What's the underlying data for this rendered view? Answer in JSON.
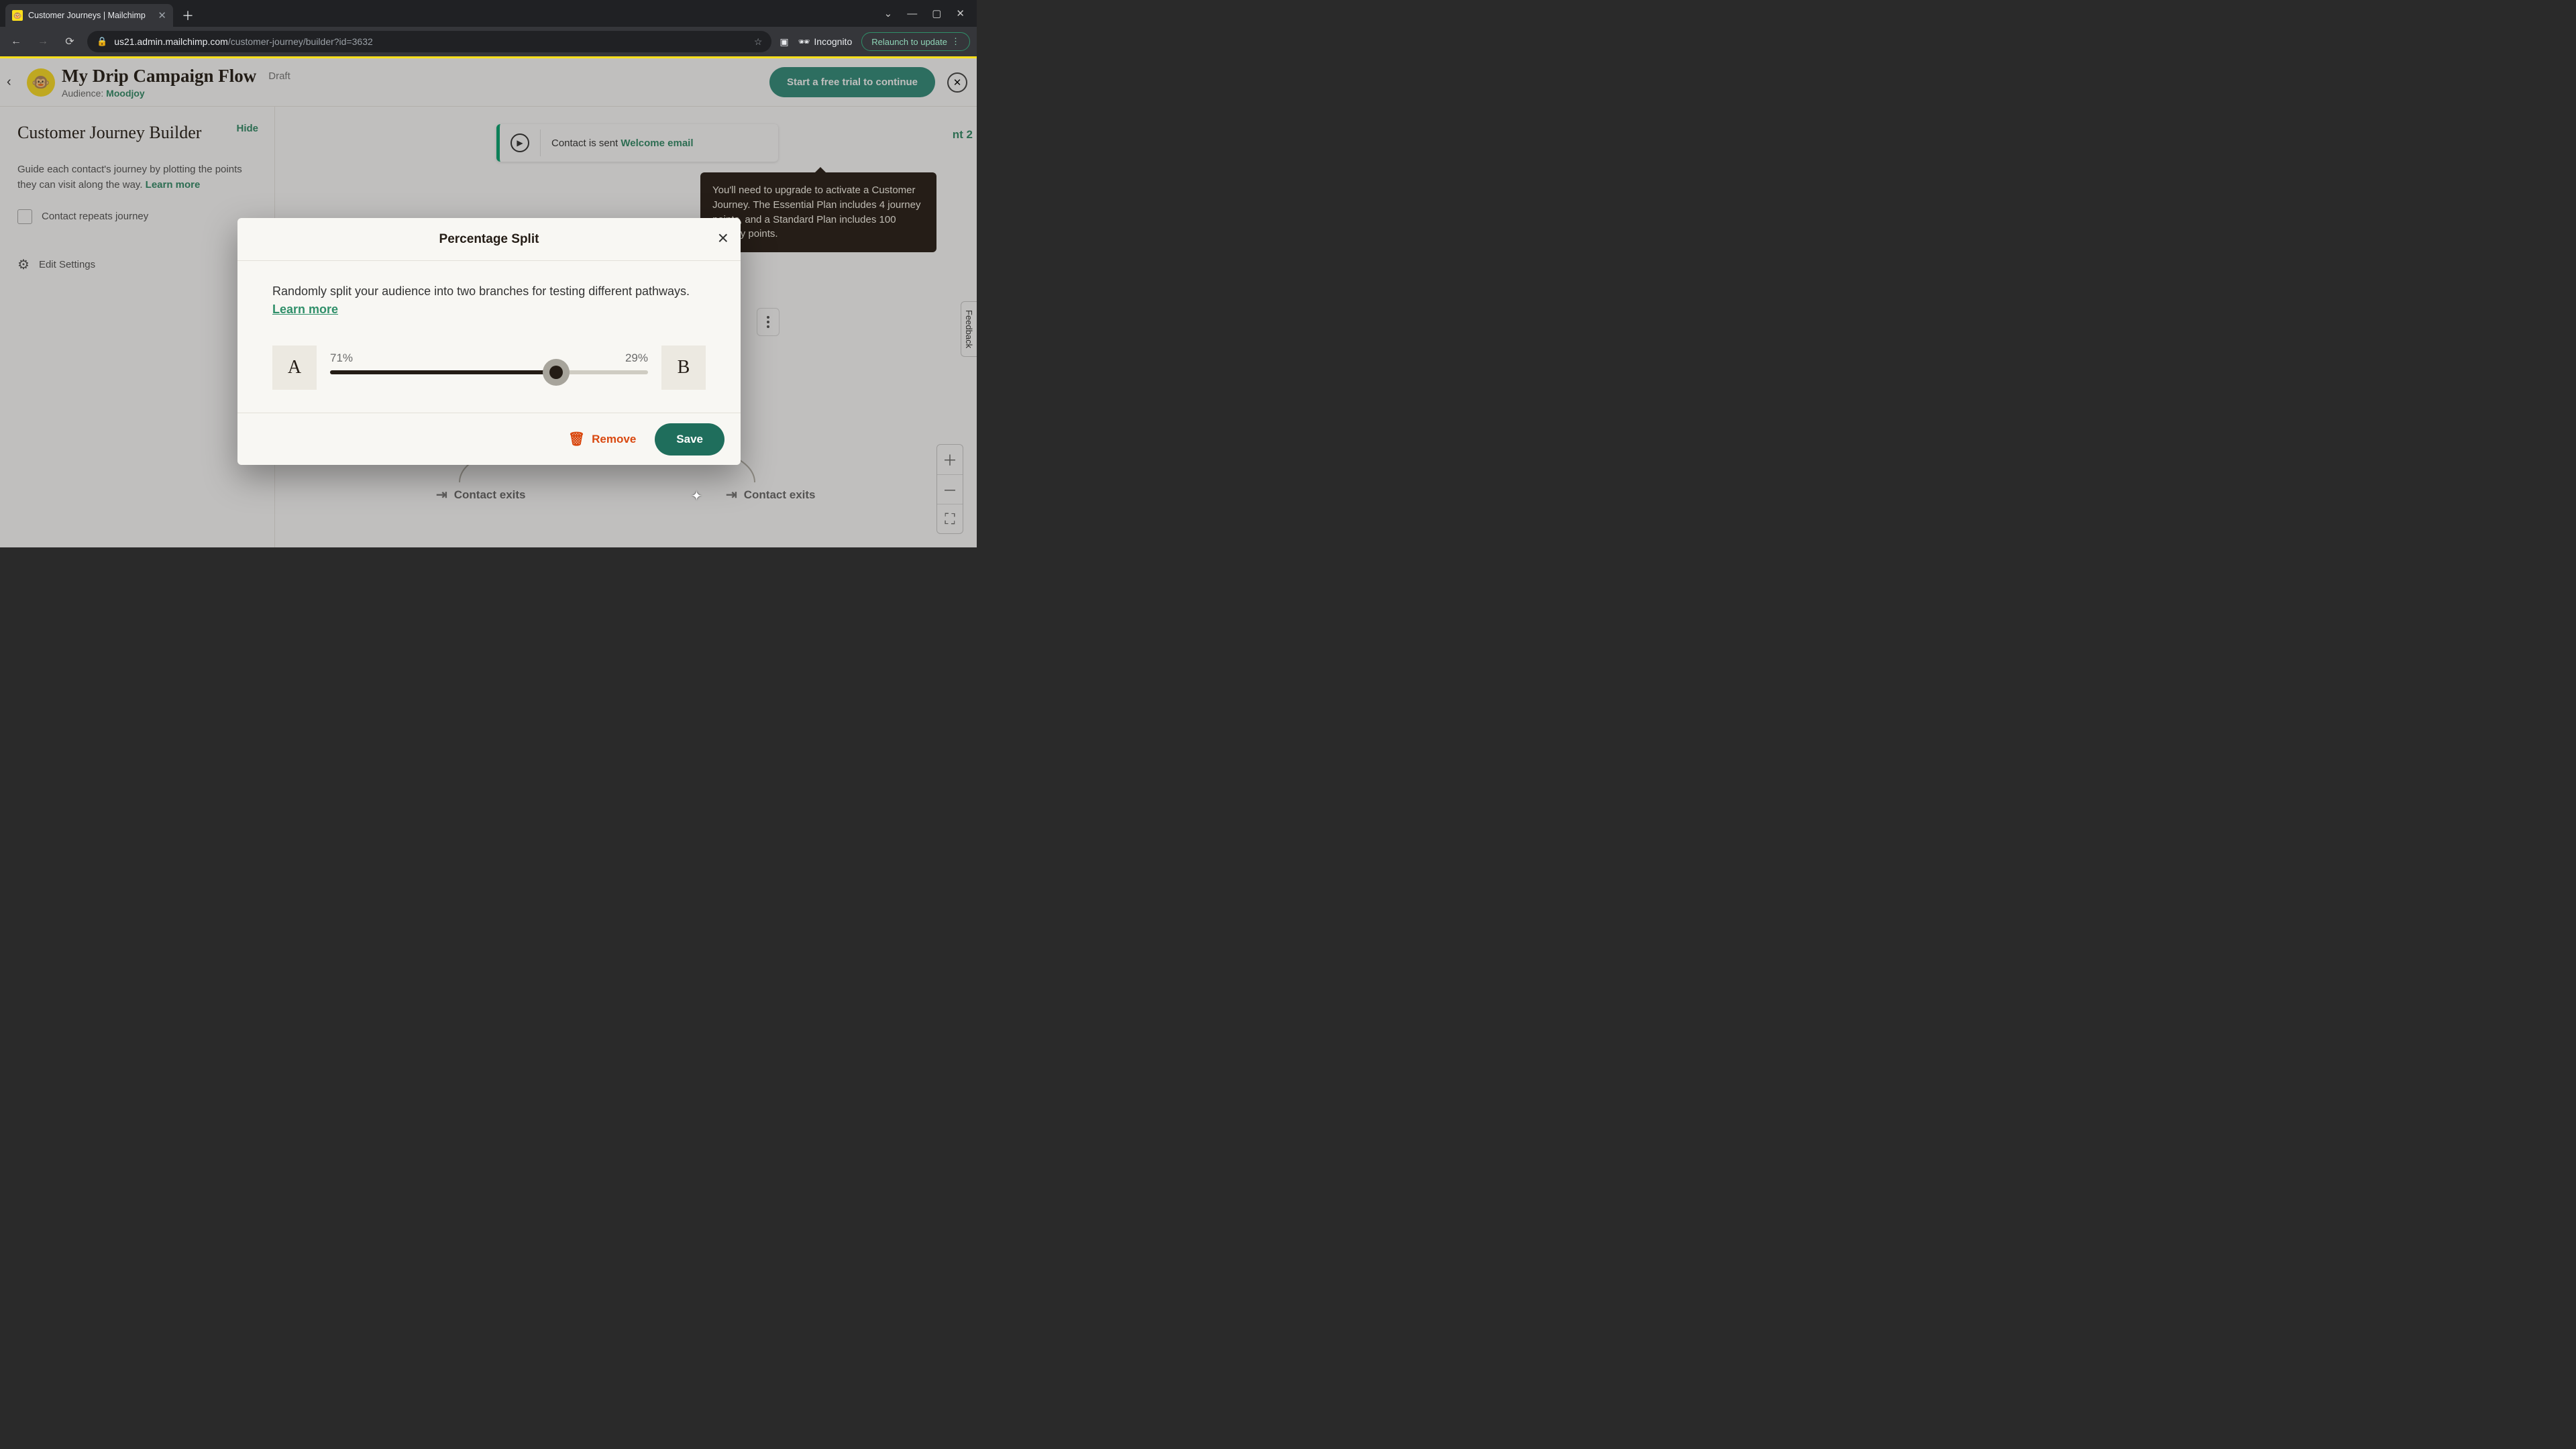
{
  "browser": {
    "tab_title": "Customer Journeys | Mailchimp",
    "url_host": "us21.admin.mailchimp.com",
    "url_path": "/customer-journey/builder?id=3632",
    "incognito_label": "Incognito",
    "relaunch_label": "Relaunch to update"
  },
  "header": {
    "title": "My Drip Campaign Flow",
    "status": "Draft",
    "audience_label": "Audience:",
    "audience_name": "Moodjoy",
    "cta": "Start a free trial to continue"
  },
  "sidebar": {
    "heading": "Customer Journey Builder",
    "hide": "Hide",
    "desc_a": "Guide each contact's journey by plotting the points they can visit along the way. ",
    "learn_more": "Learn more",
    "repeat_label": "Contact repeats journey",
    "edit_settings": "Edit Settings"
  },
  "canvas": {
    "start_prefix": "Contact is sent ",
    "start_link": "Welcome email",
    "exit_label": "Contact exits",
    "nt_badge": "nt 2",
    "feedback": "Feedback"
  },
  "tooltip": {
    "text": "You'll need to upgrade to activate a Customer Journey. The Essential Plan includes 4 journey points, and a Standard Plan includes 100 journey points."
  },
  "modal": {
    "title": "Percentage Split",
    "desc": "Randomly split your audience into two branches for testing different pathways. ",
    "learn_more": "Learn more",
    "label_a": "A",
    "label_b": "B",
    "pct_a": "71%",
    "pct_b": "29%",
    "slider_value": 71,
    "remove": "Remove",
    "save": "Save"
  }
}
